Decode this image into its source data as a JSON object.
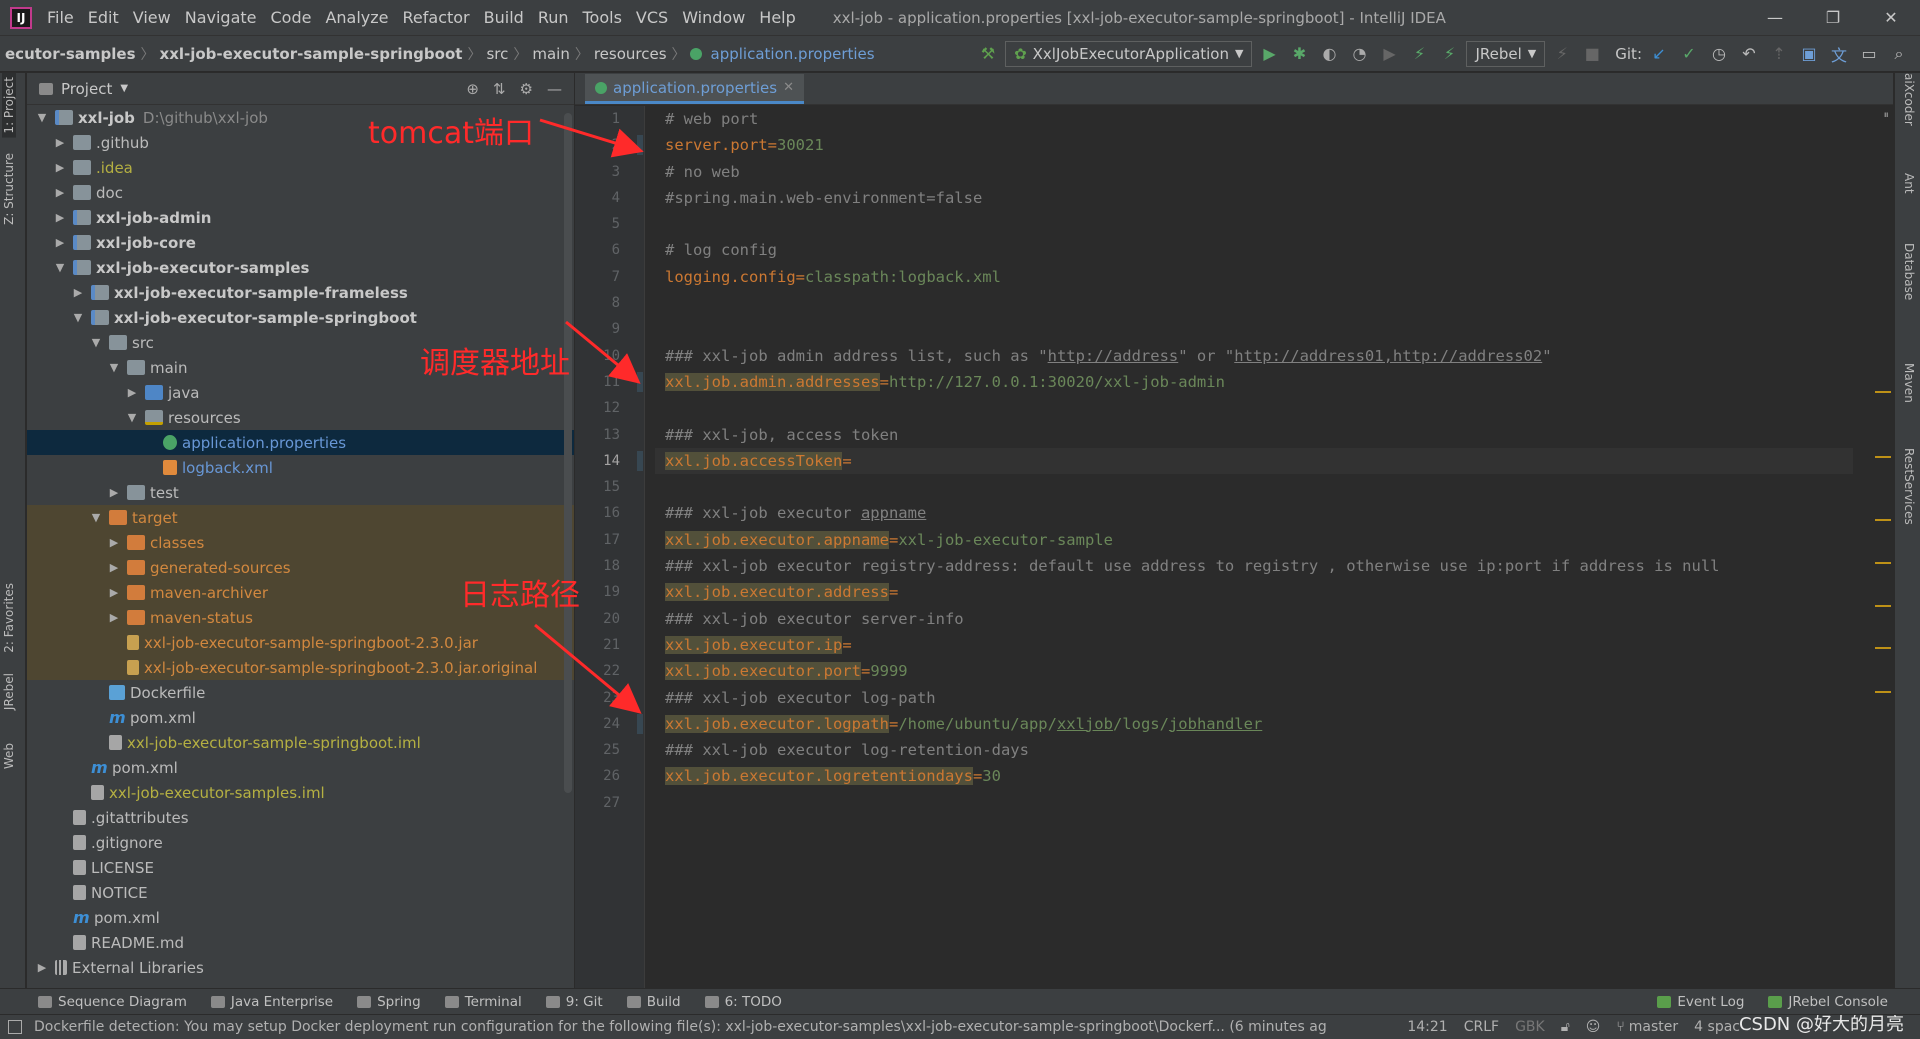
{
  "window": {
    "title": "xxl-job - application.properties [xxl-job-executor-sample-springboot] - IntelliJ IDEA",
    "menu": [
      "File",
      "Edit",
      "View",
      "Navigate",
      "Code",
      "Analyze",
      "Refactor",
      "Build",
      "Run",
      "Tools",
      "VCS",
      "Window",
      "Help"
    ]
  },
  "navbar": {
    "crumbs": [
      "ecutor-samples",
      "xxl-job-executor-sample-springboot",
      "src",
      "main",
      "resources",
      "application.properties"
    ],
    "run_config": "XxlJobExecutorApplication",
    "jrebel": "JRebel",
    "git_label": "Git:"
  },
  "left_strip": [
    "1: Project",
    "Z: Structure",
    "2: Favorites",
    "JRebel",
    "Web"
  ],
  "right_strip": [
    "aiXcoder",
    "Ant",
    "Database",
    "Maven",
    "RestServices"
  ],
  "project": {
    "header": "Project",
    "tree": [
      {
        "label": "xxl-job",
        "extra": "D:\\github\\xxl-job",
        "depth": 0,
        "arrow": "▼",
        "icon": "mod",
        "style": "bold"
      },
      {
        "label": ".github",
        "depth": 1,
        "arrow": "▶",
        "icon": "folder"
      },
      {
        "label": ".idea",
        "depth": 1,
        "arrow": "▶",
        "icon": "folder",
        "style": "yellow"
      },
      {
        "label": "doc",
        "depth": 1,
        "arrow": "▶",
        "icon": "folder"
      },
      {
        "label": "xxl-job-admin",
        "depth": 1,
        "arrow": "▶",
        "icon": "mod",
        "style": "bold"
      },
      {
        "label": "xxl-job-core",
        "depth": 1,
        "arrow": "▶",
        "icon": "mod",
        "style": "bold"
      },
      {
        "label": "xxl-job-executor-samples",
        "depth": 1,
        "arrow": "▼",
        "icon": "mod",
        "style": "bold"
      },
      {
        "label": "xxl-job-executor-sample-frameless",
        "depth": 2,
        "arrow": "▶",
        "icon": "mod",
        "style": "bold"
      },
      {
        "label": "xxl-job-executor-sample-springboot",
        "depth": 2,
        "arrow": "▼",
        "icon": "mod",
        "style": "bold"
      },
      {
        "label": "src",
        "depth": 3,
        "arrow": "▼",
        "icon": "folder"
      },
      {
        "label": "main",
        "depth": 4,
        "arrow": "▼",
        "icon": "folder"
      },
      {
        "label": "java",
        "depth": 5,
        "arrow": "▶",
        "icon": "src"
      },
      {
        "label": "resources",
        "depth": 5,
        "arrow": "▼",
        "icon": "res"
      },
      {
        "label": "application.properties",
        "depth": 6,
        "arrow": "",
        "icon": "prop",
        "style": "blue",
        "row": "sel"
      },
      {
        "label": "logback.xml",
        "depth": 6,
        "arrow": "",
        "icon": "xml",
        "style": "blue"
      },
      {
        "label": "test",
        "depth": 4,
        "arrow": "▶",
        "icon": "folder"
      },
      {
        "label": "target",
        "depth": 3,
        "arrow": "▼",
        "icon": "target",
        "style": "orange",
        "row": "excl"
      },
      {
        "label": "classes",
        "depth": 4,
        "arrow": "▶",
        "icon": "target",
        "style": "orange",
        "row": "excl"
      },
      {
        "label": "generated-sources",
        "depth": 4,
        "arrow": "▶",
        "icon": "target",
        "style": "orange",
        "row": "excl"
      },
      {
        "label": "maven-archiver",
        "depth": 4,
        "arrow": "▶",
        "icon": "target",
        "style": "orange",
        "row": "excl"
      },
      {
        "label": "maven-status",
        "depth": 4,
        "arrow": "▶",
        "icon": "target",
        "style": "orange",
        "row": "excl"
      },
      {
        "label": "xxl-job-executor-sample-springboot-2.3.0.jar",
        "depth": 4,
        "arrow": "",
        "icon": "jar",
        "style": "orange",
        "row": "excl"
      },
      {
        "label": "xxl-job-executor-sample-springboot-2.3.0.jar.original",
        "depth": 4,
        "arrow": "",
        "icon": "jar",
        "style": "orange",
        "row": "excl"
      },
      {
        "label": "Dockerfile",
        "depth": 3,
        "arrow": "",
        "icon": "dock"
      },
      {
        "label": "pom.xml",
        "depth": 3,
        "arrow": "",
        "icon": "pom"
      },
      {
        "label": "xxl-job-executor-sample-springboot.iml",
        "depth": 3,
        "arrow": "",
        "icon": "file",
        "style": "yellow"
      },
      {
        "label": "pom.xml",
        "depth": 2,
        "arrow": "",
        "icon": "pom"
      },
      {
        "label": "xxl-job-executor-samples.iml",
        "depth": 2,
        "arrow": "",
        "icon": "file",
        "style": "yellow"
      },
      {
        "label": ".gitattributes",
        "depth": 1,
        "arrow": "",
        "icon": "file"
      },
      {
        "label": ".gitignore",
        "depth": 1,
        "arrow": "",
        "icon": "file"
      },
      {
        "label": "LICENSE",
        "depth": 1,
        "arrow": "",
        "icon": "file"
      },
      {
        "label": "NOTICE",
        "depth": 1,
        "arrow": "",
        "icon": "file"
      },
      {
        "label": "pom.xml",
        "depth": 1,
        "arrow": "",
        "icon": "pom"
      },
      {
        "label": "README.md",
        "depth": 1,
        "arrow": "",
        "icon": "file"
      },
      {
        "label": "External Libraries",
        "depth": 0,
        "arrow": "▶",
        "icon": "lib"
      }
    ]
  },
  "editor": {
    "tab": "application.properties",
    "current_line": 14,
    "lines": [
      [
        [
          "cm",
          "# web port"
        ]
      ],
      [
        [
          "k",
          "server.port"
        ],
        [
          "eq",
          "="
        ],
        [
          "v",
          "30021"
        ]
      ],
      [
        [
          "cm",
          "# no web"
        ]
      ],
      [
        [
          "cm",
          "#spring.main.web-environment=false"
        ]
      ],
      [],
      [
        [
          "cm",
          "# log config"
        ]
      ],
      [
        [
          "k",
          "logging.config"
        ],
        [
          "eq",
          "="
        ],
        [
          "v",
          "classpath:logback.xml"
        ]
      ],
      [],
      [],
      [
        [
          "cm",
          "### xxl-job admin address list, such as \""
        ],
        [
          "cmu",
          "http://address"
        ],
        [
          "cm",
          "\" or \""
        ],
        [
          "cmu",
          "http://address01,http://address02"
        ],
        [
          "cm",
          "\""
        ]
      ],
      [
        [
          "kh",
          "xxl.job.admin.addresses"
        ],
        [
          "eq",
          "="
        ],
        [
          "v",
          "http://127.0.0.1:30020/xxl-job-admin"
        ]
      ],
      [],
      [
        [
          "cm",
          "### xxl-job, access token"
        ]
      ],
      [
        [
          "kh",
          "xxl.job.accessToken"
        ],
        [
          "eq",
          "="
        ]
      ],
      [],
      [
        [
          "cm",
          "### xxl-job executor "
        ],
        [
          "cmu",
          "appname"
        ]
      ],
      [
        [
          "kh",
          "xxl.job.executor.appname"
        ],
        [
          "eq",
          "="
        ],
        [
          "v",
          "xxl-job-executor-sample"
        ]
      ],
      [
        [
          "cm",
          "### xxl-job executor registry-address: default use address to registry , otherwise use ip:port if address is null"
        ]
      ],
      [
        [
          "kh",
          "xxl.job.executor.address"
        ],
        [
          "eq",
          "="
        ]
      ],
      [
        [
          "cm",
          "### xxl-job executor server-info"
        ]
      ],
      [
        [
          "kh",
          "xxl.job.executor.ip"
        ],
        [
          "eq",
          "="
        ]
      ],
      [
        [
          "kh",
          "xxl.job.executor.port"
        ],
        [
          "eq",
          "="
        ],
        [
          "v",
          "9999"
        ]
      ],
      [
        [
          "cm",
          "### xxl-job executor log-path"
        ]
      ],
      [
        [
          "kh",
          "xxl.job.executor.logpath"
        ],
        [
          "eq",
          "="
        ],
        [
          "v",
          "/home/ubuntu/app/"
        ],
        [
          "vu",
          "xxljob"
        ],
        [
          "v",
          "/logs/"
        ],
        [
          "vu",
          "jobhandler"
        ]
      ],
      [
        [
          "cm",
          "### xxl-job executor log-retention-days"
        ]
      ],
      [
        [
          "kh",
          "xxl.job.executor.logretentiondays"
        ],
        [
          "eq",
          "="
        ],
        [
          "v",
          "30"
        ]
      ],
      []
    ]
  },
  "annotations": {
    "tomcat": "tomcat端口",
    "scheduler": "调度器地址",
    "logpath": "日志路径",
    "color": "#ff2a2a"
  },
  "toolwindows": [
    "Sequence Diagram",
    "Java Enterprise",
    "Spring",
    "Terminal",
    "9: Git",
    "Build",
    "6: TODO"
  ],
  "toolwindows_right": [
    "Event Log",
    "JRebel Console"
  ],
  "status": {
    "message": "Dockerfile detection: You may setup Docker deployment run configuration for the following file(s): xxl-job-executor-samples\\xxl-job-executor-sample-springboot\\Dockerf... (6 minutes ag",
    "position": "14:21",
    "line_sep": "CRLF",
    "encoding": "GBK",
    "branch": "master",
    "indent": "4 spac",
    "watermark": "CSDN @好大的月亮"
  }
}
